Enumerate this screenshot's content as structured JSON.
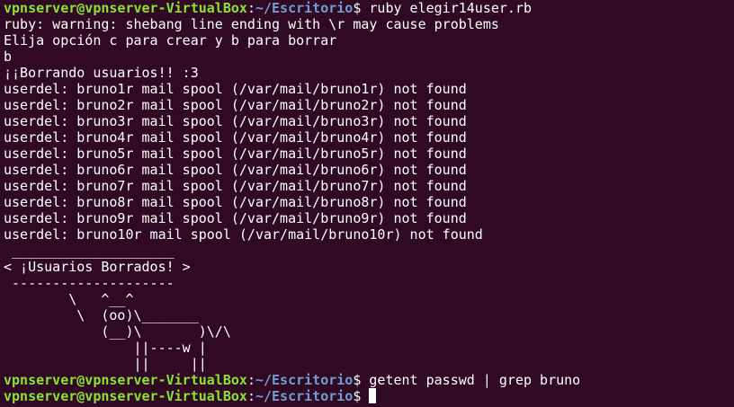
{
  "prompt": {
    "user_host": "vpnserver@vpnserver-VirtualBox",
    "separator": ":",
    "path": "~/Escritorio",
    "symbol": "$"
  },
  "colors": {
    "background": "#300a24",
    "text": "#ffffff",
    "prompt_user": "#8ae234",
    "prompt_path": "#729fcf"
  },
  "command_1": " ruby elegir14user.rb",
  "output": [
    "ruby: warning: shebang line ending with \\r may cause problems",
    "Elija opción c para crear y b para borrar",
    "b",
    "¡¡Borrando usuarios!! :3",
    "userdel: bruno1r mail spool (/var/mail/bruno1r) not found",
    "userdel: bruno2r mail spool (/var/mail/bruno2r) not found",
    "userdel: bruno3r mail spool (/var/mail/bruno3r) not found",
    "userdel: bruno4r mail spool (/var/mail/bruno4r) not found",
    "userdel: bruno5r mail spool (/var/mail/bruno5r) not found",
    "userdel: bruno6r mail spool (/var/mail/bruno6r) not found",
    "userdel: bruno7r mail spool (/var/mail/bruno7r) not found",
    "userdel: bruno8r mail spool (/var/mail/bruno8r) not found",
    "userdel: bruno9r mail spool (/var/mail/bruno9r) not found",
    "userdel: bruno10r mail spool (/var/mail/bruno10r) not found"
  ],
  "cowsay": [
    " ____________________",
    "< ¡Usuarios Borrados! >",
    " --------------------",
    "        \\   ^__^",
    "         \\  (oo)\\_______",
    "            (__)\\       )\\/\\",
    "                ||----w |",
    "                ||     ||"
  ],
  "command_2": " getent passwd | grep bruno",
  "command_3": " "
}
